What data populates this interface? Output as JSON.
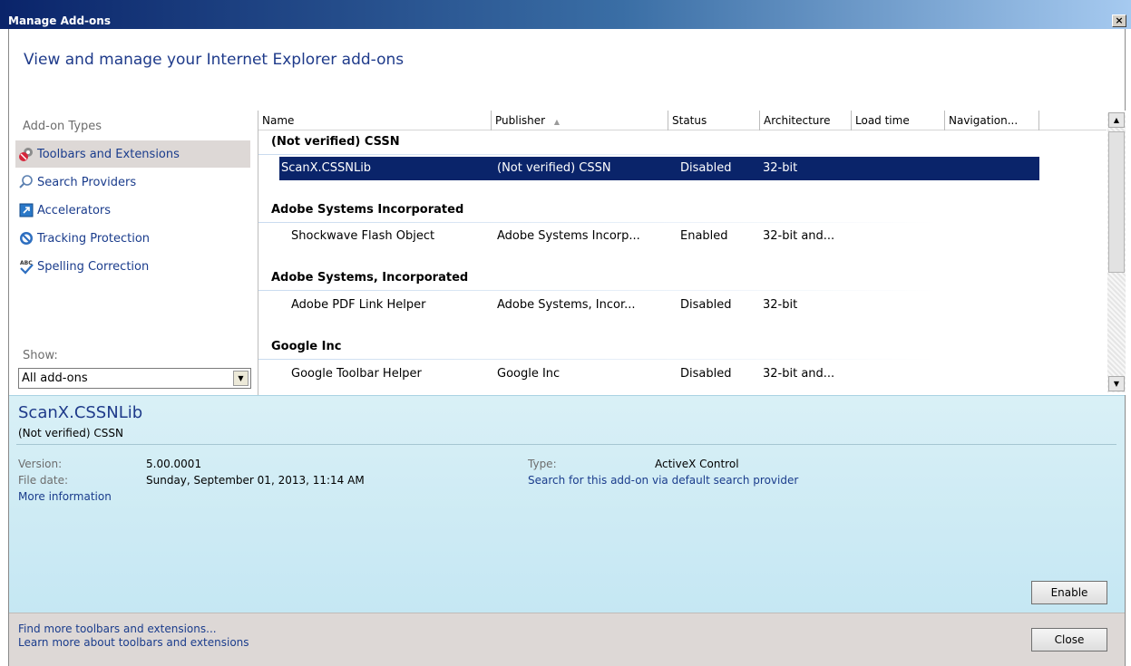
{
  "window": {
    "title": "Manage Add-ons",
    "close_glyph": "×"
  },
  "header": {
    "title": "View and manage your Internet Explorer add-ons"
  },
  "sidebar": {
    "heading": "Add-on Types",
    "items": [
      {
        "label": "Toolbars and Extensions",
        "icon": "gear-puzzle-icon"
      },
      {
        "label": "Search Providers",
        "icon": "magnifier-icon"
      },
      {
        "label": "Accelerators",
        "icon": "accelerator-icon"
      },
      {
        "label": "Tracking Protection",
        "icon": "no-entry-icon"
      },
      {
        "label": "Spelling Correction",
        "icon": "abc-check-icon"
      }
    ],
    "show_label": "Show:",
    "show_value": "All add-ons"
  },
  "table": {
    "columns": [
      "Name",
      "Publisher",
      "Status",
      "Architecture",
      "Load time",
      "Navigation..."
    ],
    "sort_indicator": "▲",
    "groups": [
      {
        "name": "(Not verified) CSSN",
        "rows": [
          {
            "name": "ScanX.CSSNLib",
            "publisher": "(Not verified) CSSN",
            "status": "Disabled",
            "architecture": "32-bit"
          }
        ]
      },
      {
        "name": "Adobe Systems Incorporated",
        "rows": [
          {
            "name": "Shockwave Flash Object",
            "publisher": "Adobe Systems Incorp...",
            "status": "Enabled",
            "architecture": "32-bit and..."
          }
        ]
      },
      {
        "name": "Adobe Systems, Incorporated",
        "rows": [
          {
            "name": "Adobe PDF Link Helper",
            "publisher": "Adobe Systems, Incor...",
            "status": "Disabled",
            "architecture": "32-bit"
          }
        ]
      },
      {
        "name": "Google Inc",
        "rows": [
          {
            "name": "Google Toolbar Helper",
            "publisher": "Google Inc",
            "status": "Disabled",
            "architecture": "32-bit and..."
          }
        ]
      }
    ]
  },
  "details": {
    "name": "ScanX.CSSNLib",
    "publisher": "(Not verified) CSSN",
    "version_label": "Version:",
    "version": "5.00.0001",
    "file_date_label": "File date:",
    "file_date": "Sunday, September 01, 2013, 11:14 AM",
    "more_info": "More information",
    "type_label": "Type:",
    "type": "ActiveX Control",
    "search_link": "Search for this add-on via default search provider",
    "enable_button": "Enable"
  },
  "footer": {
    "link1": "Find more toolbars and extensions...",
    "link2": "Learn more about toolbars and extensions",
    "close_button": "Close"
  }
}
